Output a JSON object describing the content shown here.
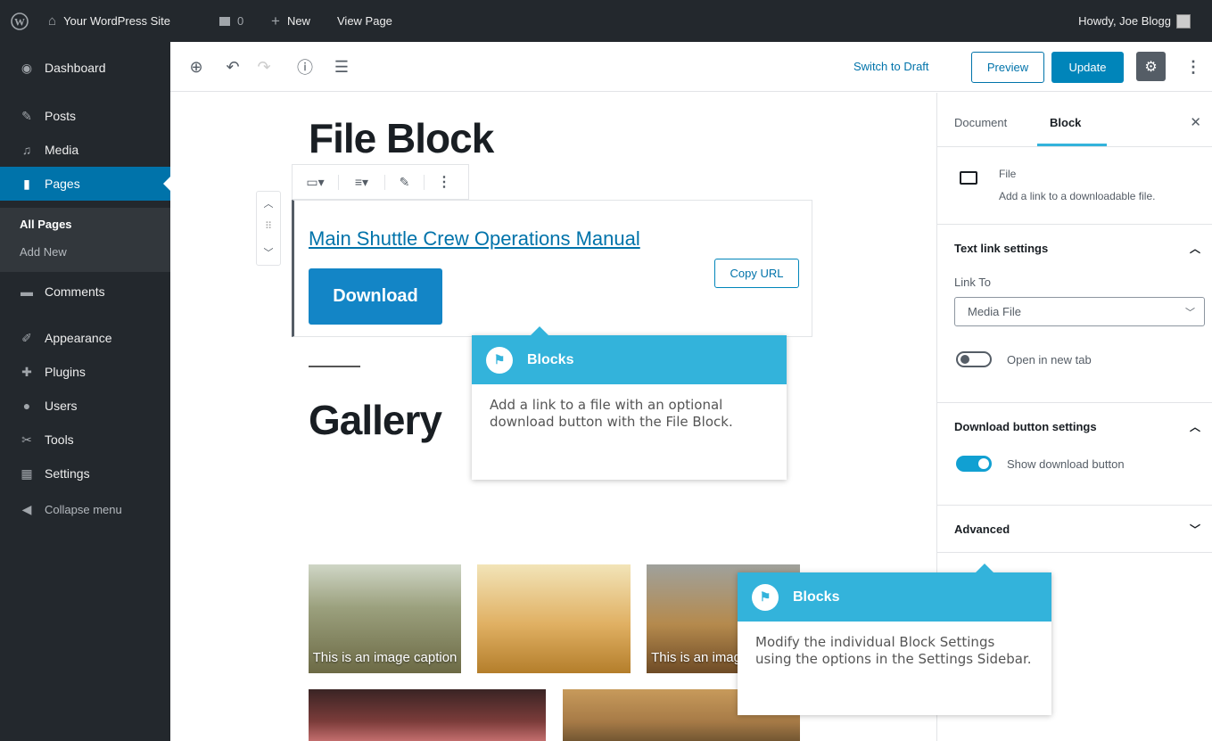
{
  "adminbar": {
    "wp_logo": "wordpress-icon",
    "site_name": "Your WordPress Site",
    "comments_count": "0",
    "new_label": "New",
    "view_page": "View Page",
    "howdy": "Howdy, Joe Blogg"
  },
  "sidebar": {
    "dashboard": "Dashboard",
    "posts": "Posts",
    "media": "Media",
    "pages": "Pages",
    "all_pages": "All Pages",
    "add_new": "Add New",
    "comments": "Comments",
    "appearance": "Appearance",
    "plugins": "Plugins",
    "users": "Users",
    "tools": "Tools",
    "settings": "Settings",
    "collapse": "Collapse menu"
  },
  "toolbar": {
    "switch_to_draft": "Switch to Draft",
    "preview": "Preview",
    "update": "Update"
  },
  "editor": {
    "title": "File Block",
    "file_link": "Main Shuttle Crew Operations Manual",
    "copy_url": "Copy URL",
    "download": "Download",
    "gallery_heading": "Gallery",
    "captions": [
      "This is an image caption",
      "This is an image caption"
    ]
  },
  "settings_sidebar": {
    "tab_document": "Document",
    "tab_block": "Block",
    "block_name": "File",
    "block_desc": "Add a link to a downloadable file.",
    "text_link_settings": "Text link settings",
    "link_to_label": "Link To",
    "link_to_value": "Media File",
    "open_new_tab": "Open in new tab",
    "download_button_settings": "Download button settings",
    "show_download_button": "Show download button",
    "advanced": "Advanced"
  },
  "tooltips": {
    "one_title": "Blocks",
    "one_body": "Add a link to a file with an optional download button with the File Block.",
    "two_title": "Blocks",
    "two_body": "Modify the individual Block Settings using the options in the Settings Sidebar."
  },
  "colors": {
    "accent": "#0073aa",
    "admin_bg": "#23282d",
    "tooltip_head": "#33b3db"
  }
}
